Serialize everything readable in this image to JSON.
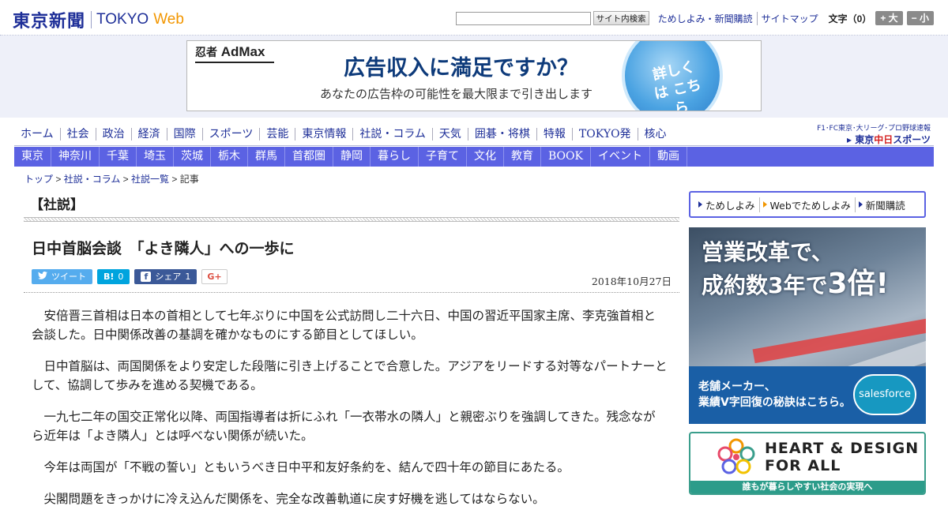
{
  "header": {
    "logo_kanji": "東京新聞",
    "logo_tokyo": "TOKYO",
    "logo_web": "Web",
    "search_placeholder": "",
    "search_button": "サイト内検索",
    "links": [
      "ためしよみ・新聞購読",
      "サイトマップ"
    ],
    "font_size_label": "文字（0）",
    "font_bigger": "+ 大",
    "font_smaller": "− 小"
  },
  "ad_banner": {
    "brand_ninja": "忍者",
    "brand_admax": "AdMax",
    "headline": "広告収入に満足ですか？",
    "subline": "あなたの広告枠の可能性を最大限まで引き出します",
    "bubble": "詳しくは こちら"
  },
  "nav_main": [
    "ホーム",
    "社会",
    "政治",
    "経済",
    "国際",
    "スポーツ",
    "芸能",
    "東京情報",
    "社説・コラム",
    "天気",
    "囲碁・将棋",
    "特報",
    "TOKYO発",
    "核心"
  ],
  "nav_side": {
    "top": "F1･FC東京･大リーグ･プロ野球速報",
    "main_prefix": "▸ 東京",
    "main_red": "中日",
    "main_suffix": "スポーツ"
  },
  "nav_regions": [
    "東京",
    "神奈川",
    "千葉",
    "埼玉",
    "茨城",
    "栃木",
    "群馬",
    "首都圏",
    "静岡",
    "暮らし",
    "子育て",
    "文化",
    "教育",
    "BOOK",
    "イベント",
    "動画"
  ],
  "breadcrumb": {
    "items": [
      "トップ",
      "社説・コラム",
      "社説一覧"
    ],
    "current": "記事",
    "sep": " > "
  },
  "article": {
    "section": "【社説】",
    "title": "日中首脳会談　「よき隣人」への一歩に",
    "date": "2018年10月27日",
    "social": {
      "tweet": "ツイート",
      "hatena_icon": "B!",
      "hatena_count": "0",
      "fb_share": "シェア",
      "fb_count": "1",
      "gplus": "G+"
    },
    "paragraphs": [
      "安倍晋三首相は日本の首相として七年ぶりに中国を公式訪問し二十六日、中国の習近平国家主席、李克強首相と会談した。日中関係改善の基調を確かなものにする節目としてほしい。",
      "日中首脳は、両国関係をより安定した段階に引き上げることで合意した。アジアをリードする対等なパートナーとして、協調して歩みを進める契機である。",
      "一九七二年の国交正常化以降、両国指導者は折にふれ「一衣帯水の隣人」と親密ぶりを強調してきた。残念ながら近年は「よき隣人」とは呼べない関係が続いた。",
      "今年は両国が「不戦の誓い」ともいうべき日中平和友好条約を、結んで四十年の節目にあたる。",
      "尖閣問題をきっかけに冷え込んだ関係を、完全な改善軌道に戻す好機を逃してはならない。"
    ]
  },
  "sidebar": {
    "subscribe": [
      "ためしよみ",
      "Webでためしよみ",
      "新聞購読"
    ],
    "sf_ad": {
      "line1": "営業改革で、",
      "line2a": "成約数3年で",
      "line2b": "3倍!",
      "bottom1": "老舗メーカー、",
      "bottom2": "業績V字回復の秘訣はこちら。",
      "brand": "salesforce"
    },
    "hd_ad": {
      "title1": "HEART & DESIGN",
      "title2": "FOR ALL",
      "bar": "誰もが暮らしやすい社会の実現へ"
    }
  },
  "colors": {
    "brand_blue": "#1e2f98",
    "nav_blue": "#5b62e3",
    "web_orange": "#f29600",
    "twitter": "#55acee",
    "hatena": "#00a4de",
    "facebook": "#3b5998"
  }
}
